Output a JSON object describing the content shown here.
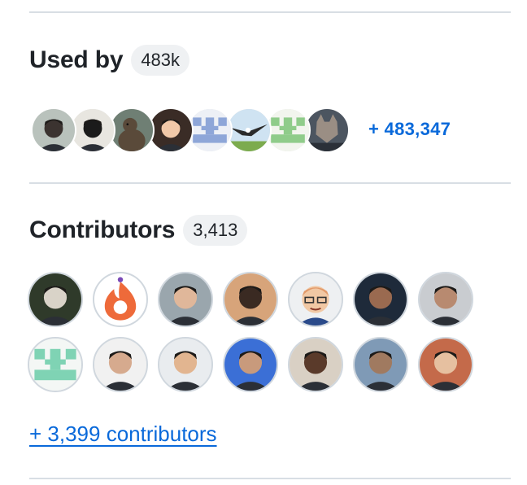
{
  "used_by": {
    "title": "Used by",
    "count_badge": "483k",
    "more_count": "+ 483,347",
    "avatars": [
      {
        "icon": "user-photo-icon",
        "bg": "#b9c2bc",
        "fg": "#3b3330"
      },
      {
        "icon": "user-photo-icon",
        "bg": "#e8e6e0",
        "fg": "#1b1b1b"
      },
      {
        "icon": "otter-avatar-icon",
        "bg": "#6f7f74",
        "fg": "#5a4a3a"
      },
      {
        "icon": "user-photo-icon",
        "bg": "#3a2c26",
        "fg": "#f0c8a8"
      },
      {
        "icon": "identicon-icon",
        "bg": "#edf0f6",
        "fg": "#8ea6d8"
      },
      {
        "icon": "eagle-avatar-icon",
        "bg": "#cfe3f2",
        "fg": "#2b2b2b"
      },
      {
        "icon": "identicon-icon",
        "bg": "#f2f5ee",
        "fg": "#8fcc8a"
      },
      {
        "icon": "wolf-avatar-icon",
        "bg": "#4c5560",
        "fg": "#9a8e84"
      }
    ]
  },
  "contributors": {
    "title": "Contributors",
    "count_badge": "3,413",
    "more_link": "+ 3,399 contributors",
    "avatars": [
      {
        "icon": "user-photo-icon",
        "bg": "#2f3a2a",
        "fg": "#d9d3c8"
      },
      {
        "icon": "flame-logo-icon",
        "bg": "#ffffff",
        "fg": "#ee6a3a"
      },
      {
        "icon": "user-photo-icon",
        "bg": "#9aa6ad",
        "fg": "#e0b79a"
      },
      {
        "icon": "user-photo-icon",
        "bg": "#d7a47a",
        "fg": "#3a2a22"
      },
      {
        "icon": "cartoon-avatar-icon",
        "bg": "#eef0f2",
        "fg": "#e29a6a"
      },
      {
        "icon": "user-photo-icon",
        "bg": "#1e2a3a",
        "fg": "#9a6a50"
      },
      {
        "icon": "user-photo-icon",
        "bg": "#c9ccd0",
        "fg": "#b88a70"
      },
      {
        "icon": "identicon-icon",
        "bg": "#f4f7f5",
        "fg": "#7fd3b4"
      },
      {
        "icon": "user-photo-icon",
        "bg": "#f1f1f1",
        "fg": "#d6aa8e"
      },
      {
        "icon": "user-photo-icon",
        "bg": "#e9ecef",
        "fg": "#e2b590"
      },
      {
        "icon": "user-photo-icon",
        "bg": "#3b6fd6",
        "fg": "#c89a7c"
      },
      {
        "icon": "user-photo-icon",
        "bg": "#d9d0c4",
        "fg": "#5a3a2a"
      },
      {
        "icon": "user-photo-icon",
        "bg": "#7f9ab6",
        "fg": "#a07a60"
      },
      {
        "icon": "user-photo-icon",
        "bg": "#c46a4a",
        "fg": "#e6c0a0"
      }
    ]
  },
  "colors": {
    "link": "#0969da",
    "divider": "#d8dee4",
    "badge_bg": "#eff1f3"
  }
}
